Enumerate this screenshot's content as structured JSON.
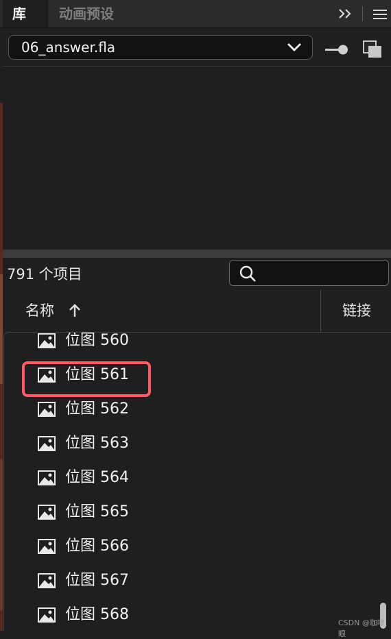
{
  "tabs": {
    "library_label": "库",
    "motion_presets_label": "动画预设"
  },
  "document": {
    "selected": "06_answer.fla"
  },
  "library": {
    "item_count": "791 个项目",
    "search": {
      "value": "",
      "placeholder": ""
    },
    "columns": {
      "name": "名称",
      "linkage": "链接"
    },
    "items": [
      {
        "label": "位图 560",
        "icon": "bitmap-icon"
      },
      {
        "label": "位图 561",
        "icon": "bitmap-icon"
      },
      {
        "label": "位图 562",
        "icon": "bitmap-icon"
      },
      {
        "label": "位图 563",
        "icon": "bitmap-icon"
      },
      {
        "label": "位图 564",
        "icon": "bitmap-icon"
      },
      {
        "label": "位图 565",
        "icon": "bitmap-icon"
      },
      {
        "label": "位图 566",
        "icon": "bitmap-icon"
      },
      {
        "label": "位图 567",
        "icon": "bitmap-icon"
      },
      {
        "label": "位图 568",
        "icon": "bitmap-icon"
      }
    ],
    "highlighted_item": "位图 561"
  },
  "colors": {
    "panel_bg": "#1f1f1f",
    "tab_bar_bg": "#2b2b2b",
    "highlight_border": "#ff5a66"
  },
  "watermark": "CSDN @咖啡眼"
}
